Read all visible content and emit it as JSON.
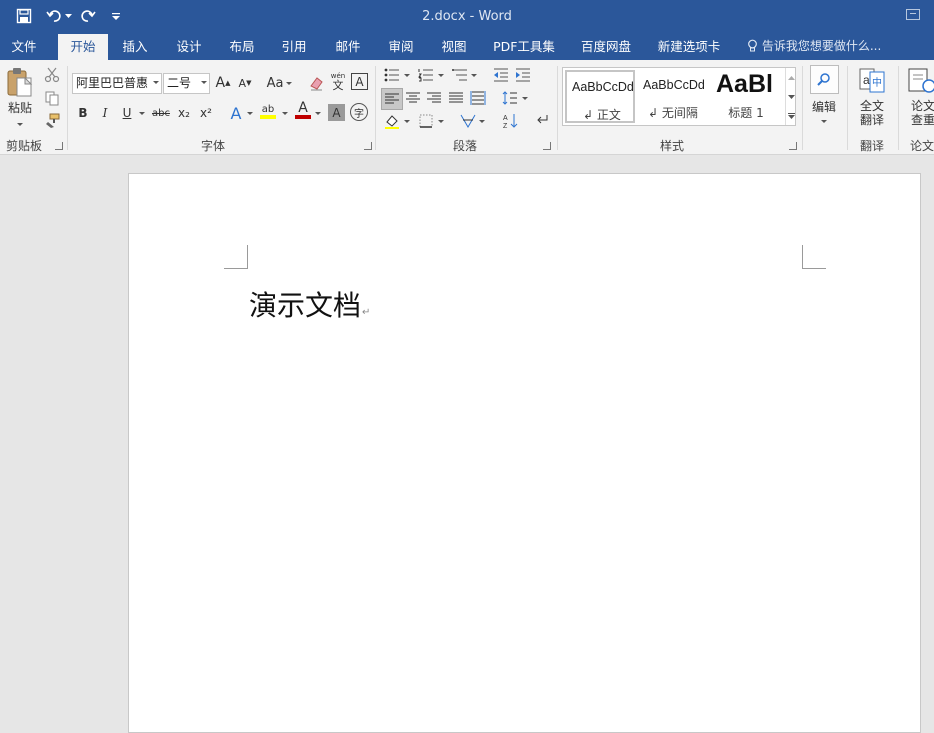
{
  "window": {
    "title": "2.docx - Word"
  },
  "quick_access": {
    "save": "save-icon",
    "undo": "undo-icon",
    "redo": "redo-icon",
    "customize": "customize-icon"
  },
  "tabs": [
    {
      "label": "文件",
      "active": false
    },
    {
      "label": "开始",
      "active": true
    },
    {
      "label": "插入",
      "active": false
    },
    {
      "label": "设计",
      "active": false
    },
    {
      "label": "布局",
      "active": false
    },
    {
      "label": "引用",
      "active": false
    },
    {
      "label": "邮件",
      "active": false
    },
    {
      "label": "审阅",
      "active": false
    },
    {
      "label": "视图",
      "active": false
    },
    {
      "label": "PDF工具集",
      "active": false
    },
    {
      "label": "百度网盘",
      "active": false
    },
    {
      "label": "新建选项卡",
      "active": false
    }
  ],
  "tell_me": "告诉我您想要做什么...",
  "ribbon": {
    "clipboard": {
      "label": "剪贴板",
      "paste_label": "粘贴"
    },
    "font": {
      "label": "字体",
      "font_name": "阿里巴巴普惠",
      "font_size": "二号",
      "change_case": "Aa",
      "bold": "B",
      "italic": "I",
      "underline": "U",
      "strikethrough": "abc",
      "subscript": "x₂",
      "superscript": "x²",
      "phonetic_top": "wén",
      "phonetic_bottom": "文",
      "char_border": "A",
      "shading": "A",
      "enclose": "字",
      "font_color": "#c00000",
      "highlight_color": "#ffff00"
    },
    "paragraph": {
      "label": "段落"
    },
    "styles": {
      "label": "样式",
      "items": [
        {
          "sample": "AaBbCcDd",
          "name": "正文"
        },
        {
          "sample": "AaBbCcDd",
          "name": "无间隔"
        },
        {
          "sample": "AaBl",
          "name": "标题 1"
        }
      ]
    },
    "editing": {
      "label": "编辑"
    },
    "translate": {
      "label": "翻译",
      "full_line1": "全文",
      "full_line2": "翻译"
    },
    "thesis": {
      "label": "论文",
      "line1": "论文",
      "line2": "查重"
    }
  },
  "document": {
    "text": "演示文档",
    "paragraph_mark": "↵"
  },
  "colors": {
    "accent": "#2b579a",
    "ribbon_bg": "#f3f3f3",
    "canvas_bg": "#e6e6e6"
  }
}
